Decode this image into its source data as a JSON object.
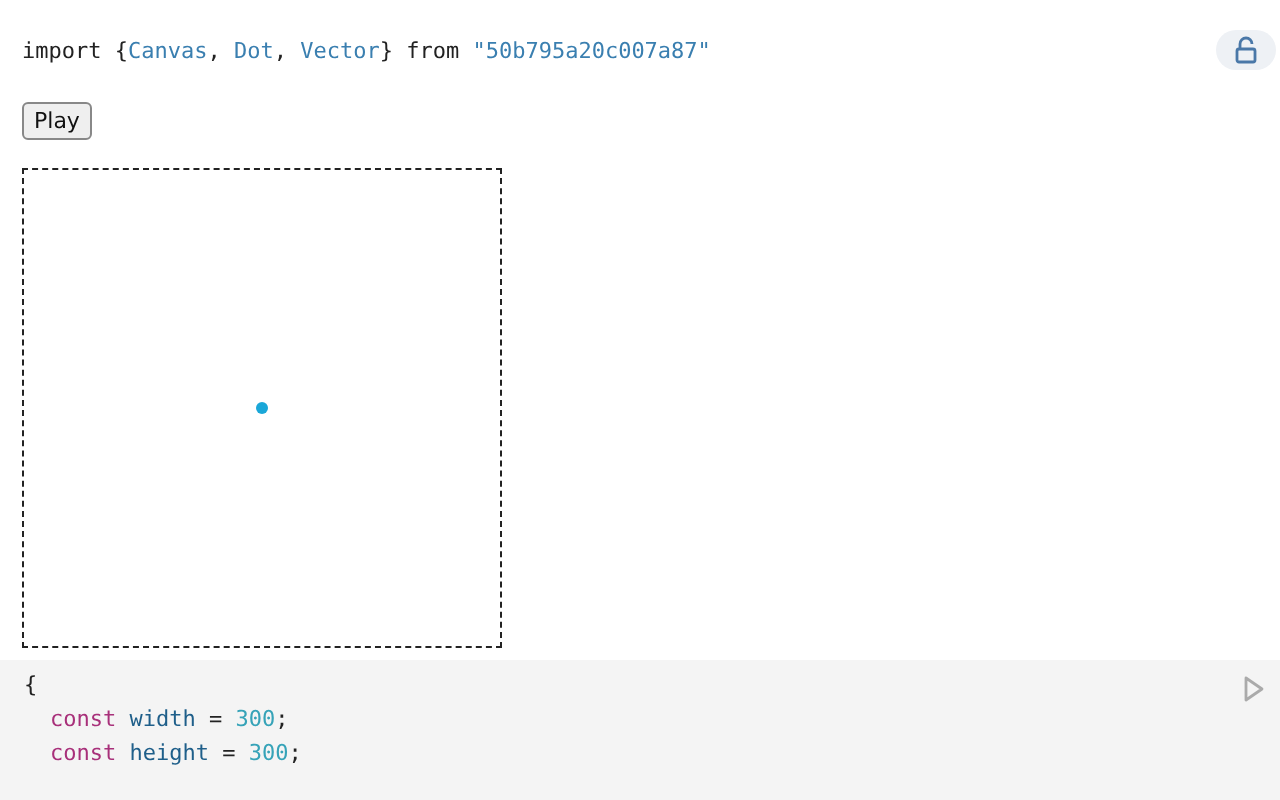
{
  "import_line": [
    {
      "text": "import {",
      "kind": "plain"
    },
    {
      "text": "Canvas",
      "kind": "name"
    },
    {
      "text": ", ",
      "kind": "plain"
    },
    {
      "text": "Dot",
      "kind": "name"
    },
    {
      "text": ", ",
      "kind": "plain"
    },
    {
      "text": "Vector",
      "kind": "name"
    },
    {
      "text": "} from ",
      "kind": "plain"
    },
    {
      "text": "\"50b795a20c007a87\"",
      "kind": "string"
    }
  ],
  "play_button": "Play",
  "canvas": {
    "dot": true
  },
  "code": [
    {
      "kind": "block",
      "tokens": [
        {
          "text": "{",
          "kind": "plain"
        }
      ]
    },
    {
      "kind": "statement",
      "tokens": [
        {
          "text": "const",
          "kind": "keyword"
        },
        {
          "text": " width",
          "kind": "variable"
        },
        {
          "text": " = ",
          "kind": "plain"
        },
        {
          "text": "300",
          "kind": "number"
        },
        {
          "text": ";",
          "kind": "plain"
        }
      ]
    },
    {
      "kind": "statement",
      "tokens": [
        {
          "text": "const",
          "kind": "keyword"
        },
        {
          "text": " height",
          "kind": "variable"
        },
        {
          "text": " = ",
          "kind": "plain"
        },
        {
          "text": "300",
          "kind": "number"
        },
        {
          "text": ";",
          "kind": "plain"
        }
      ]
    }
  ]
}
